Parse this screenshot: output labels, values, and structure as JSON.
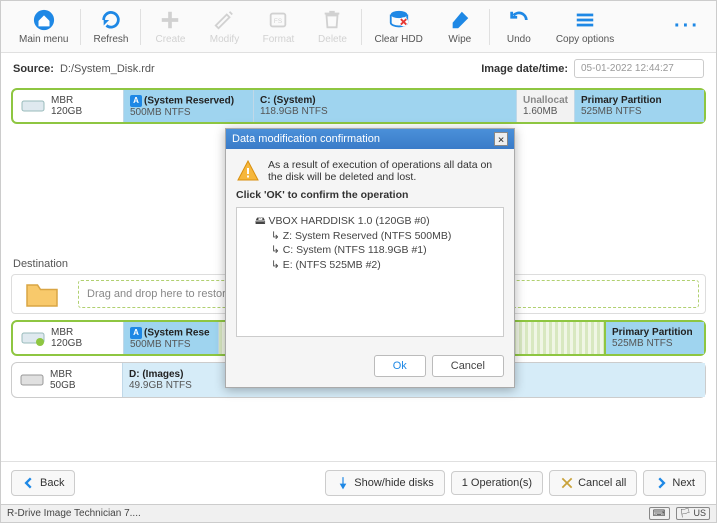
{
  "toolbar": {
    "main_menu": "Main menu",
    "refresh": "Refresh",
    "create": "Create",
    "modify": "Modify",
    "format": "Format",
    "delete": "Delete",
    "clear_hdd": "Clear HDD",
    "wipe": "Wipe",
    "undo": "Undo",
    "copy_options": "Copy options"
  },
  "source_label": "Source:",
  "source_path": "D:/System_Disk.rdr",
  "image_dt_label": "Image date/time:",
  "image_dt_value": "05-01-2022 12:44:27",
  "disk_src": {
    "mbr": "MBR",
    "size": "120GB",
    "parts": [
      {
        "title": "(System Reserved)",
        "sub": "500MB NTFS",
        "flag": "A"
      },
      {
        "title": "C: (System)",
        "sub": "118.9GB NTFS",
        "flag": ""
      },
      {
        "title": "Unallocat",
        "sub": "1.60MB",
        "flag": ""
      },
      {
        "title": "Primary Partition",
        "sub": "525MB NTFS",
        "flag": ""
      }
    ]
  },
  "destination_label": "Destination",
  "drop_hint": "Drag and drop here to restore f",
  "disk_dst1": {
    "mbr": "MBR",
    "size": "120GB",
    "parts": [
      {
        "title": "(System Rese",
        "sub": "500MB NTFS",
        "flag": "A"
      },
      {
        "title": "Primary Partition",
        "sub": "525MB NTFS",
        "flag": ""
      }
    ]
  },
  "disk_dst2": {
    "mbr": "MBR",
    "size": "50GB",
    "parts": [
      {
        "title": "D: (Images)",
        "sub": "49.9GB NTFS",
        "flag": ""
      }
    ]
  },
  "bottom": {
    "back": "Back",
    "showhide": "Show/hide disks",
    "ops": "1 Operation(s)",
    "cancel_all": "Cancel all",
    "next": "Next"
  },
  "status_title": "R-Drive Image Technician 7....",
  "status_lang": "US",
  "dialog": {
    "title": "Data modification confirmation",
    "warn_text": "As a result of execution of operations all data on the disk will be deleted and lost.",
    "confirm_text": "Click 'OK' to confirm the operation",
    "items": [
      "VBOX HARDDISK 1.0 (120GB #0)",
      "Z: System Reserved (NTFS 500MB)",
      "C: System (NTFS 118.9GB #1)",
      "E: (NTFS 525MB #2)"
    ],
    "ok": "Ok",
    "cancel": "Cancel"
  }
}
